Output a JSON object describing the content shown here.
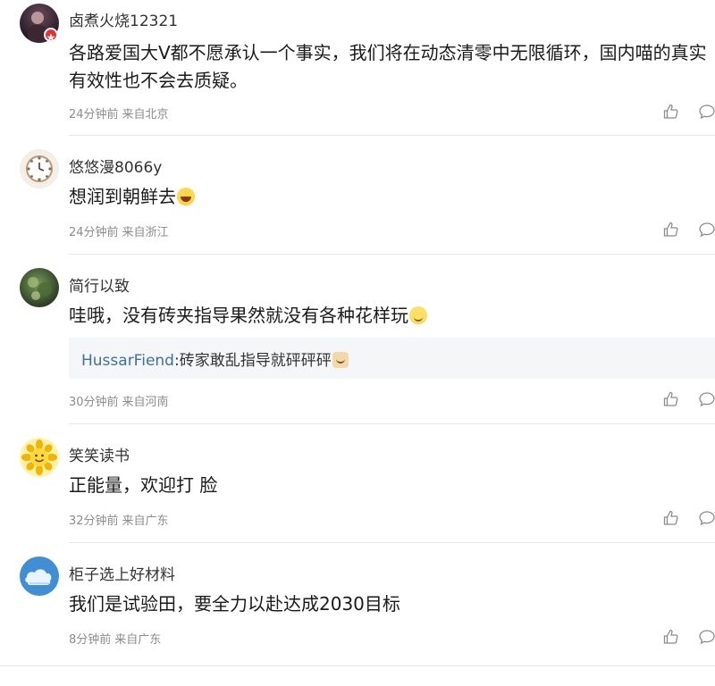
{
  "comments": [
    {
      "username": "卤煮火烧12321",
      "content": "各路爱国大V都不愿承认一个事实，我们将在动态清零中无限循环，国内喵的真实有效性也不会去质疑。",
      "time": "24分钟前",
      "location": "来自北京"
    },
    {
      "username": "悠悠漫8066y",
      "content": "想润到朝鲜去",
      "time": "24分钟前",
      "location": "来自浙江"
    },
    {
      "username": "简行以致",
      "content": "哇哦，没有砖夹指导果然就没有各种花样玩",
      "reply": {
        "user": "HussarFiend",
        "colon": ":",
        "text": "砖家敢乱指导就砰砰砰"
      },
      "time": "30分钟前",
      "location": "来自河南"
    },
    {
      "username": "笑笑读书",
      "content": "正能量，欢迎打 脸",
      "time": "32分钟前",
      "location": "来自广东"
    },
    {
      "username": "柜子选上好材料",
      "content": "我们是试验田，要全力以赴达成2030目标",
      "time": "8分钟前",
      "location": "来自广东"
    }
  ],
  "icons": {
    "like": "thumbs-up-icon",
    "reply": "comment-bubble-icon"
  },
  "colors": {
    "reply_user": "#3d6fa7",
    "meta": "#8c8c8c",
    "reply_bg": "#f5f6f8"
  }
}
